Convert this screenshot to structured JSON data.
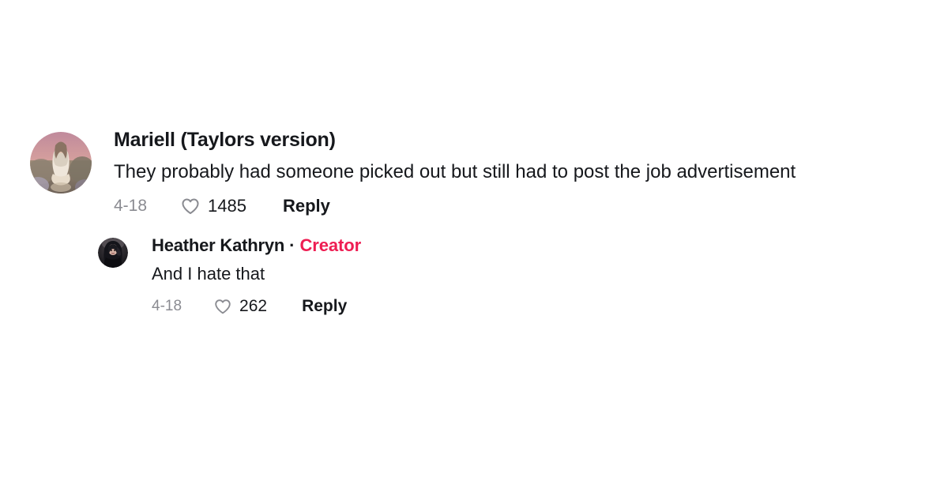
{
  "theme": {
    "background": "#ffffff",
    "text_primary": "#16181c",
    "text_muted": "#8a8b91",
    "creator_accent": "#ee1d52"
  },
  "comments": [
    {
      "author": "Mariell (Taylors version)",
      "is_creator": false,
      "text": "They probably had someone picked out but still had to post the job advertisement",
      "date": "4-18",
      "like_count": "1485",
      "reply_label": "Reply",
      "heart_icon": "heart-outline-icon",
      "avatar": {
        "name": "avatar-mariell",
        "description": "woman in white dress seated outdoors at sunset",
        "colors": [
          "#b9889a",
          "#d8a9a6",
          "#efe2d6",
          "#7e6a63",
          "#a89a8c"
        ]
      }
    },
    {
      "author": "Heather Kathryn",
      "is_creator": true,
      "separator": "·",
      "creator_label": "Creator",
      "text": "And I hate that",
      "date": "4-18",
      "like_count": "262",
      "reply_label": "Reply",
      "heart_icon": "heart-outline-icon",
      "avatar": {
        "name": "avatar-heather-kathryn",
        "description": "dark portrait of a person with long hair",
        "colors": [
          "#1b1b1f",
          "#3a343a",
          "#6f6a6e",
          "#0e0e11"
        ]
      }
    }
  ]
}
